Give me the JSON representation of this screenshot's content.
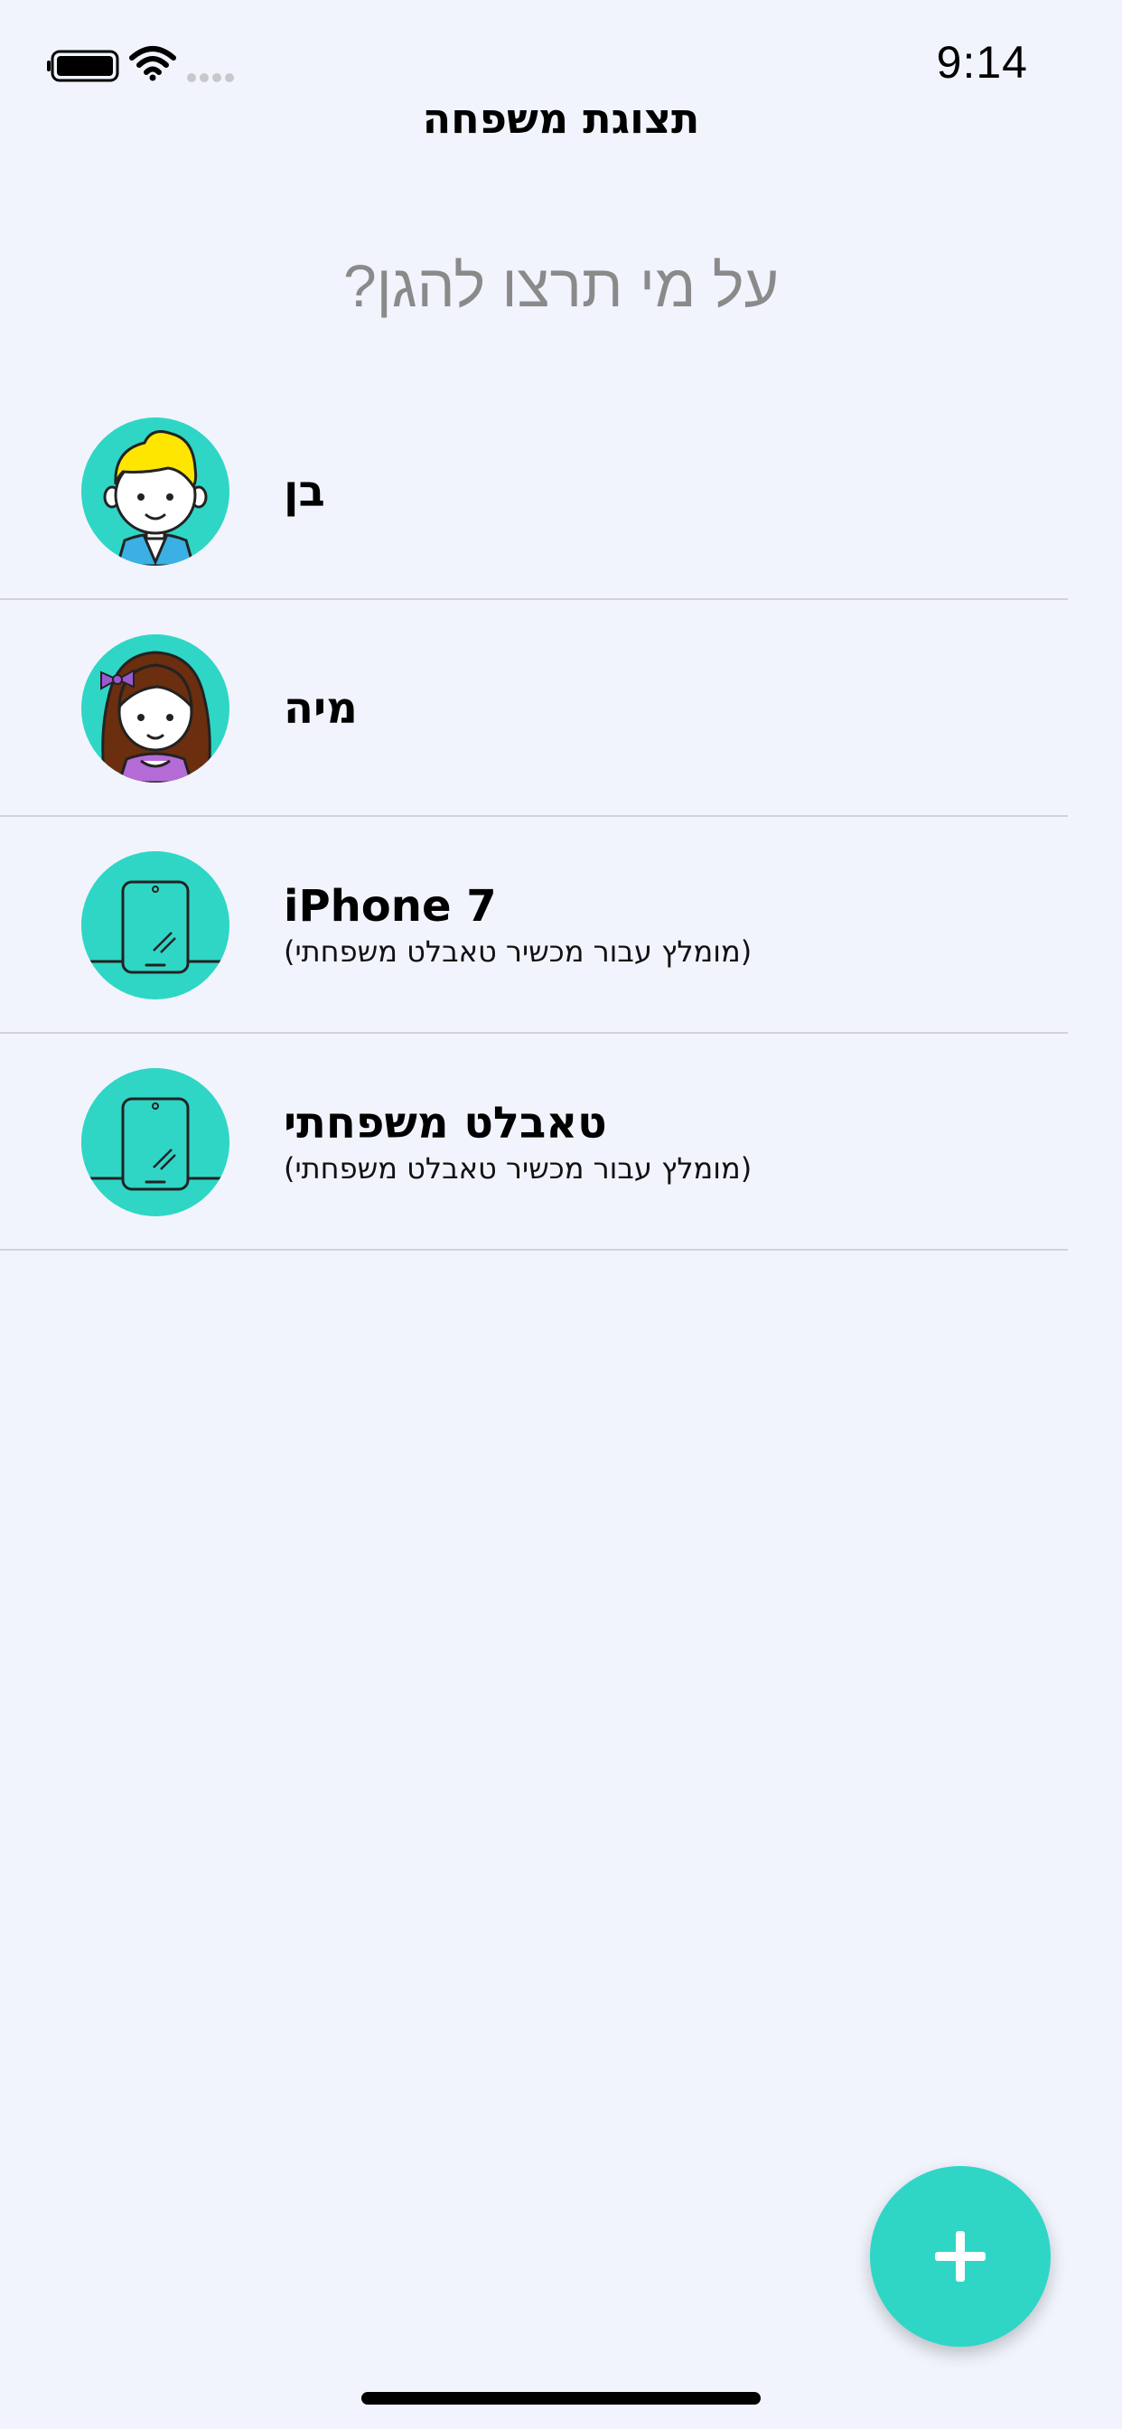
{
  "status_bar": {
    "time": "9:14",
    "battery_icon": "battery-icon",
    "wifi_icon": "wifi-icon",
    "signal_icon": "signal-icon"
  },
  "header": {
    "title": "תצוגת משפחה"
  },
  "prompt": {
    "text": "על מי תרצו להגן?"
  },
  "members": [
    {
      "name": "בן",
      "subtitle": "",
      "avatar_icon": "boy-avatar-icon"
    },
    {
      "name": "מיה",
      "subtitle": "",
      "avatar_icon": "girl-avatar-icon"
    },
    {
      "name": "iPhone 7",
      "subtitle": "(מומלץ עבור מכשיר טאבלט משפחתי)",
      "avatar_icon": "tablet-icon"
    },
    {
      "name": "טאבלט משפחתי",
      "subtitle": "(מומלץ עבור מכשיר טאבלט משפחתי)",
      "avatar_icon": "tablet-icon"
    }
  ],
  "fab": {
    "icon": "plus-icon"
  },
  "colors": {
    "accent": "#2fd6c6",
    "background": "#f1f4fc",
    "prompt_text": "#8a8a8a",
    "divider": "#d2d2d8"
  }
}
